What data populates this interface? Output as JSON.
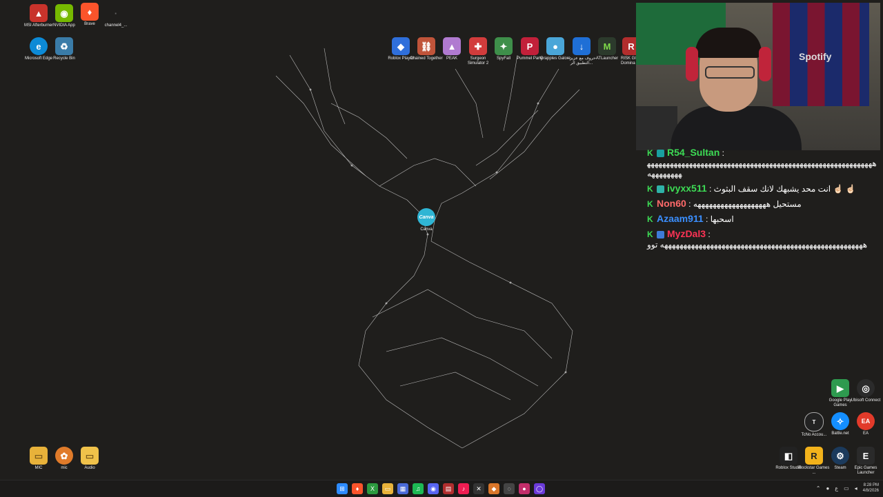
{
  "desktop_icons_left": [
    {
      "label": "MSI Afterburner",
      "icon": "msi-afterburner-icon",
      "color": "#c8332b",
      "symbol": "▲"
    },
    {
      "label": "NVIDIA App",
      "icon": "nvidia-icon",
      "color": "#76b900",
      "symbol": "◉"
    },
    {
      "label": "Brave",
      "icon": "brave-icon",
      "color": "#fb542b",
      "symbol": "♦"
    },
    {
      "label": "channel4_...",
      "icon": "file-icon",
      "color": "#1e1d1b",
      "symbol": "·"
    },
    {
      "label": "Microsoft Edge",
      "icon": "edge-icon",
      "color": "#0c8ad6",
      "symbol": "e"
    },
    {
      "label": "Recycle Bin",
      "icon": "recycle-bin-icon",
      "color": "#3a7ca8",
      "symbol": "♻"
    }
  ],
  "desktop_icons_top": [
    {
      "label": "Roblox Player",
      "icon": "roblox-icon",
      "color": "#2f6fdb",
      "symbol": "◆"
    },
    {
      "label": "Chained Together",
      "icon": "chained-together-icon",
      "color": "#c0543a",
      "symbol": "⛓"
    },
    {
      "label": "PEAK",
      "icon": "peak-icon",
      "color": "#b07ad0",
      "symbol": "▲"
    },
    {
      "label": "Surgeon Simulator 2",
      "icon": "surgeon-icon",
      "color": "#d23c3c",
      "symbol": "✚"
    },
    {
      "label": "SpyFall",
      "icon": "spyfall-icon",
      "color": "#3e8f4a",
      "symbol": "✦"
    },
    {
      "label": "Pummel Party",
      "icon": "pummel-party-icon",
      "color": "#c2203a",
      "symbol": "P"
    },
    {
      "label": "Grapples Galore",
      "icon": "grapples-icon",
      "color": "#4aa6d8",
      "symbol": "●"
    },
    {
      "label": "حروف مع عزيز - التطبيق الر...",
      "icon": "download-icon",
      "color": "#1f6fd6",
      "symbol": "↓"
    },
    {
      "label": "ATLauncher",
      "icon": "atlauncher-icon",
      "color": "#2c3a2c",
      "symbol": "M"
    },
    {
      "label": "RISK Gl Domina",
      "icon": "risk-icon",
      "color": "#b22d2d",
      "symbol": "R"
    }
  ],
  "desktop_icons_bottom_left": [
    {
      "label": "MIC",
      "icon": "folder-icon",
      "color": "#e8b23a",
      "symbol": "▭"
    },
    {
      "label": "mic",
      "icon": "fl-studio-icon",
      "color": "#e07b2a",
      "symbol": "✿"
    },
    {
      "label": "Audio",
      "icon": "folder-icon",
      "color": "#f0c24a",
      "symbol": "▭"
    }
  ],
  "desktop_icons_right": [
    {
      "label": "Google Play Games",
      "icon": "google-play-games-icon",
      "color": "#2e9a4f",
      "symbol": "▶"
    },
    {
      "label": "Ubisoft Connect",
      "icon": "ubisoft-icon",
      "color": "#2b2b2b",
      "symbol": "◎"
    },
    {
      "label": "TcNo Accou...",
      "icon": "tcno-icon",
      "color": "#222222",
      "symbol": "T"
    },
    {
      "label": "Battle.net",
      "icon": "battlenet-icon",
      "color": "#148eff",
      "symbol": "✧"
    },
    {
      "label": "EA",
      "icon": "ea-icon",
      "color": "#e23a2a",
      "symbol": "EA"
    },
    {
      "label": "Roblox Studio",
      "icon": "roblox-studio-icon",
      "color": "#222222",
      "symbol": "◧"
    },
    {
      "label": "Rockstar Games ...",
      "icon": "rockstar-icon",
      "color": "#f2b21b",
      "symbol": "R"
    },
    {
      "label": "Steam",
      "icon": "steam-icon",
      "color": "#1b3a5c",
      "symbol": "⚙"
    },
    {
      "label": "Epic Games Launcher",
      "icon": "epic-games-icon",
      "color": "#2a2a2a",
      "symbol": "E"
    }
  ],
  "center_icon": {
    "label": "Canva",
    "icon": "canva-icon",
    "color": "#2fb5d4",
    "symbol": "Canva"
  },
  "webcam": {
    "jersey_text": "Spotify"
  },
  "chat": [
    {
      "user": "R54_Sultan",
      "user_color": "#3ddc55",
      "badge_color": "#19a0a0",
      "text": "ههههههههههههههههههههههههههههههههههههههههههههههههههههههههههههههههههههه"
    },
    {
      "user": "ivyxx511",
      "user_color": "#3ddc55",
      "badge_color": "#2fb2a8",
      "text": "انت محد يشبهك لانك سقف البثوث ☝🏻 ☝🏻"
    },
    {
      "user": "Non60",
      "user_color": "#ff6a6a",
      "badge_color": "",
      "text": "مستحيل هههههههههههههههههههه"
    },
    {
      "user": "Azaam911",
      "user_color": "#3b8fff",
      "badge_color": "",
      "text": "اسحبها"
    },
    {
      "user": "MyzDal3",
      "user_color": "#ff3355",
      "badge_color": "#3e7bd8",
      "text": "هههههههههههههههههههههههههههههههههههههههههههههههههههههه توو"
    }
  ],
  "taskbar": {
    "icons": [
      {
        "name": "start-icon",
        "color": "#2d8bff",
        "symbol": "⊞"
      },
      {
        "name": "brave-icon",
        "color": "#fb542b",
        "symbol": "♦"
      },
      {
        "name": "xbox-icon",
        "color": "#2c9a3f",
        "symbol": "X"
      },
      {
        "name": "file-explorer-icon",
        "color": "#e8b23a",
        "symbol": "▭"
      },
      {
        "name": "calendar-icon",
        "color": "#4a6ad8",
        "symbol": "▦"
      },
      {
        "name": "spotify-icon",
        "color": "#1db954",
        "symbol": "♫"
      },
      {
        "name": "discord-icon",
        "color": "#5865f2",
        "symbol": "◉"
      },
      {
        "name": "video-icon",
        "color": "#b12e2e",
        "symbol": "▤"
      },
      {
        "name": "tiktok-icon",
        "color": "#ee1d52",
        "symbol": "♪"
      },
      {
        "name": "capcut-icon",
        "color": "#333333",
        "symbol": "✕"
      },
      {
        "name": "app-icon",
        "color": "#d9762a",
        "symbol": "◆"
      },
      {
        "name": "obs-icon",
        "color": "#444444",
        "symbol": "◌"
      },
      {
        "name": "app2-icon",
        "color": "#c22d6a",
        "symbol": "●"
      },
      {
        "name": "app3-icon",
        "color": "#6a3ad8",
        "symbol": "◯"
      }
    ],
    "time": "8:28 PM",
    "date": "4/8/2026",
    "lang": "ع"
  }
}
